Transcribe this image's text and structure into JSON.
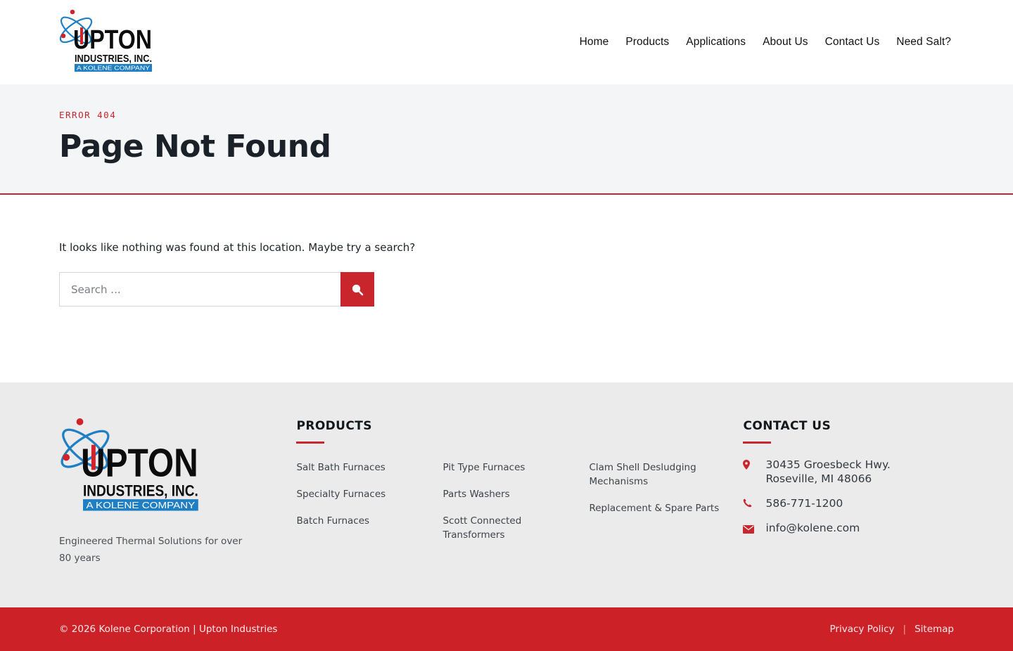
{
  "header": {
    "logo": {
      "word": "UPTON",
      "sub": "INDUSTRIES, INC.",
      "band": "A KOLENE COMPANY"
    },
    "nav": [
      "Home",
      "Products",
      "Applications",
      "About Us",
      "Contact Us",
      "Need Salt?"
    ]
  },
  "hero": {
    "eyebrow": "ERROR 404",
    "title": "Page Not Found"
  },
  "main": {
    "message": "It looks like nothing was found at this location. Maybe try a search?",
    "search_placeholder": "Search ..."
  },
  "footer": {
    "tagline": "Engineered Thermal Solutions for over 80 years",
    "products_heading": "PRODUCTS",
    "products": [
      [
        "Salt Bath Furnaces",
        "Specialty Furnaces",
        "Batch Furnaces"
      ],
      [
        "Pit Type Furnaces",
        "Parts Washers",
        "Scott Connected Transformers"
      ],
      [
        "Clam Shell Desludging Mechanisms",
        "Replacement & Spare Parts"
      ]
    ],
    "contact_heading": "CONTACT US",
    "contact": {
      "address_line1": "30435 Groesbeck Hwy.",
      "address_line2": "Roseville, MI 48066",
      "phone": "586-771-1200",
      "email": "info@kolene.com"
    }
  },
  "bottom": {
    "copyright": "© 2026 Kolene Corporation | Upton Industries",
    "links": [
      "Privacy Policy",
      "Sitemap"
    ]
  },
  "colors": {
    "accent": "#cd2128",
    "logo_blue": "#1f7fc4",
    "text": "#1b2128"
  },
  "icons": {
    "search": "search-icon",
    "address": "map-marker-icon",
    "phone": "phone-icon",
    "email": "envelope-icon"
  }
}
